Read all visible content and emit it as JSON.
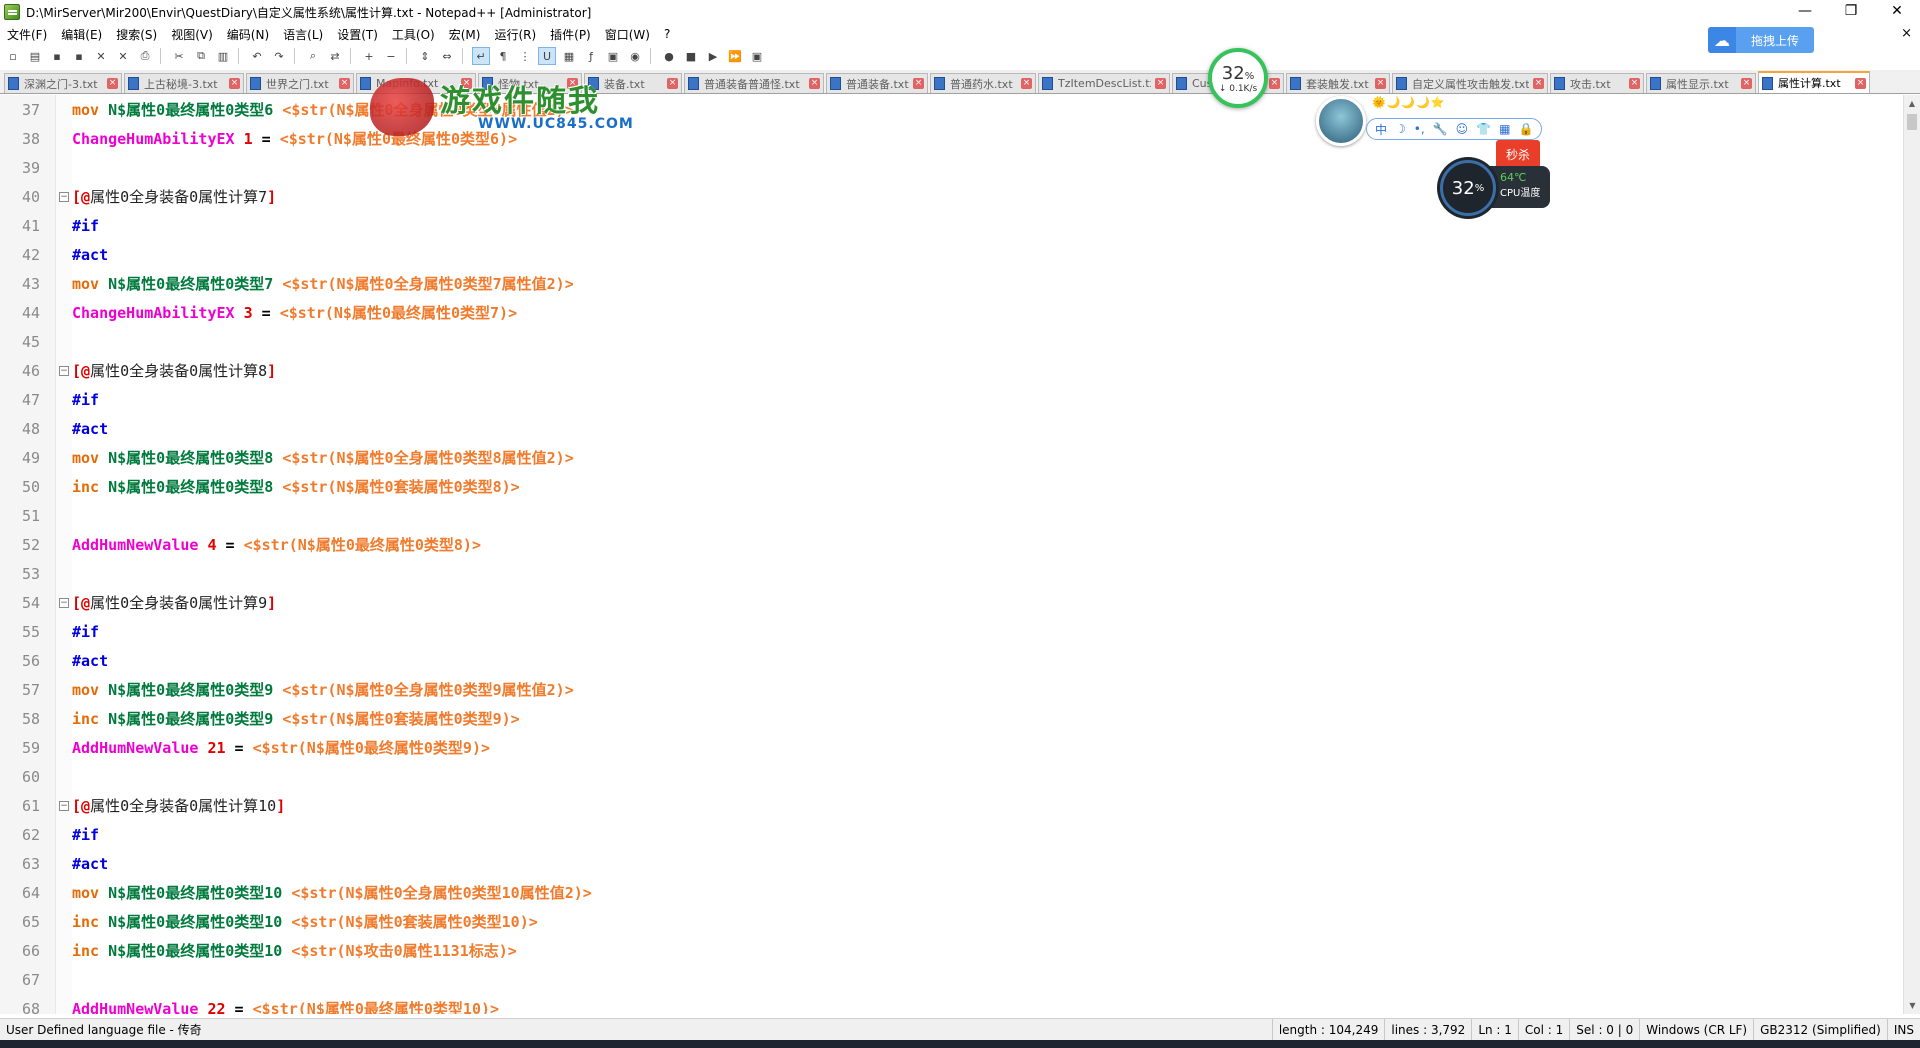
{
  "window": {
    "title": "D:\\MirServer\\Mir200\\Envir\\QuestDiary\\自定义属性系统\\属性计算.txt - Notepad++ [Administrator]",
    "controls": [
      "—",
      "❐",
      "✕"
    ]
  },
  "menu": {
    "items": [
      "文件(F)",
      "编辑(E)",
      "搜索(S)",
      "视图(V)",
      "编码(N)",
      "语言(L)",
      "设置(T)",
      "工具(O)",
      "宏(M)",
      "运行(R)",
      "插件(P)",
      "窗口(W)",
      "?"
    ],
    "close": "×"
  },
  "toolbar": {
    "icons": [
      "new-file-icon",
      "open-file-icon",
      "save-icon",
      "save-all-icon",
      "close-icon",
      "close-all-icon",
      "print-icon",
      "sep",
      "cut-icon",
      "copy-icon",
      "paste-icon",
      "sep",
      "undo-icon",
      "redo-icon",
      "sep",
      "find-icon",
      "replace-icon",
      "sep",
      "zoom-in-icon",
      "zoom-out-icon",
      "sep",
      "sync-v-icon",
      "sync-h-icon",
      "sep",
      "word-wrap-icon",
      "show-all-icon",
      "indent-guide-icon",
      "udl-icon",
      "doc-map-icon",
      "function-list-icon",
      "folder-workspace-icon",
      "monitor-icon",
      "sep",
      "record-macro-icon",
      "stop-macro-icon",
      "play-macro-icon",
      "run-macro-multiple-icon",
      "save-macro-icon"
    ],
    "glyphs": [
      "▫",
      "▤",
      "▪",
      "▪",
      "✕",
      "✕",
      "⎙",
      "",
      "✂",
      "⧉",
      "▥",
      "",
      "↶",
      "↷",
      "",
      "⌕",
      "⇄",
      "",
      "+",
      "−",
      "",
      "⇕",
      "⇔",
      "",
      "↵",
      "¶",
      "⋮",
      "U",
      "▦",
      "ƒ",
      "▣",
      "◉",
      "",
      "●",
      "■",
      "▶",
      "⏩",
      "▣"
    ]
  },
  "upload": {
    "label": "拖拽上传",
    "icon": "cloud-icon"
  },
  "tabs": [
    {
      "label": "深渊之门-3.txt"
    },
    {
      "label": "上古秘境-3.txt"
    },
    {
      "label": "世界之门.txt"
    },
    {
      "label": "Mapinfo.txt"
    },
    {
      "label": "怪物.txt"
    },
    {
      "label": "装备.txt"
    },
    {
      "label": "普通装备普通怪.txt"
    },
    {
      "label": "普通装备.txt"
    },
    {
      "label": "普通药水.txt"
    },
    {
      "label": "TzItemDescList.txt"
    },
    {
      "label": "Cust.txt"
    },
    {
      "label": "套装触发.txt"
    },
    {
      "label": "自定义属性攻击触发.txt"
    },
    {
      "label": "攻击.txt"
    },
    {
      "label": "属性显示.txt"
    },
    {
      "label": "属性计算.txt",
      "active": true
    }
  ],
  "editor": {
    "lines": [
      {
        "n": "37",
        "tokens": [
          [
            "kw",
            "mov "
          ],
          [
            "var",
            "N$属性0最终属性0类型6 "
          ],
          [
            "str",
            "<$str(N$属性0全身属性0类型6属性值2)>"
          ]
        ]
      },
      {
        "n": "38",
        "tokens": [
          [
            "fn",
            "ChangeHumAbilityEX "
          ],
          [
            "num",
            "1"
          ],
          [
            "op",
            " = "
          ],
          [
            "str",
            "<$str(N$属性0最终属性0类型6)>"
          ]
        ]
      },
      {
        "n": "39",
        "tokens": []
      },
      {
        "n": "40",
        "fold": true,
        "tokens": [
          [
            "br",
            "[@"
          ],
          [
            "lbl",
            "属性0全身装备0属性计算7"
          ],
          [
            "br",
            "]"
          ]
        ]
      },
      {
        "n": "41",
        "tokens": [
          [
            "dir",
            "#if"
          ]
        ]
      },
      {
        "n": "42",
        "tokens": [
          [
            "dir",
            "#act"
          ]
        ]
      },
      {
        "n": "43",
        "tokens": [
          [
            "kw",
            "mov "
          ],
          [
            "var",
            "N$属性0最终属性0类型7 "
          ],
          [
            "str",
            "<$str(N$属性0全身属性0类型7属性值2)>"
          ]
        ]
      },
      {
        "n": "44",
        "tokens": [
          [
            "fn",
            "ChangeHumAbilityEX "
          ],
          [
            "num",
            "3"
          ],
          [
            "op",
            " = "
          ],
          [
            "str",
            "<$str(N$属性0最终属性0类型7)>"
          ]
        ]
      },
      {
        "n": "45",
        "tokens": []
      },
      {
        "n": "46",
        "fold": true,
        "tokens": [
          [
            "br",
            "[@"
          ],
          [
            "lbl",
            "属性0全身装备0属性计算8"
          ],
          [
            "br",
            "]"
          ]
        ]
      },
      {
        "n": "47",
        "tokens": [
          [
            "dir",
            "#if"
          ]
        ]
      },
      {
        "n": "48",
        "tokens": [
          [
            "dir",
            "#act"
          ]
        ]
      },
      {
        "n": "49",
        "tokens": [
          [
            "kw",
            "mov "
          ],
          [
            "var",
            "N$属性0最终属性0类型8 "
          ],
          [
            "str",
            "<$str(N$属性0全身属性0类型8属性值2)>"
          ]
        ]
      },
      {
        "n": "50",
        "tokens": [
          [
            "kw",
            "inc "
          ],
          [
            "var",
            "N$属性0最终属性0类型8 "
          ],
          [
            "str",
            "<$str(N$属性0套装属性0类型8)>"
          ]
        ]
      },
      {
        "n": "51",
        "tokens": []
      },
      {
        "n": "52",
        "tokens": [
          [
            "fn",
            "AddHumNewValue "
          ],
          [
            "num",
            "4"
          ],
          [
            "op",
            " = "
          ],
          [
            "str",
            "<$str(N$属性0最终属性0类型8)>"
          ]
        ]
      },
      {
        "n": "53",
        "tokens": []
      },
      {
        "n": "54",
        "fold": true,
        "tokens": [
          [
            "br",
            "[@"
          ],
          [
            "lbl",
            "属性0全身装备0属性计算9"
          ],
          [
            "br",
            "]"
          ]
        ]
      },
      {
        "n": "55",
        "tokens": [
          [
            "dir",
            "#if"
          ]
        ]
      },
      {
        "n": "56",
        "tokens": [
          [
            "dir",
            "#act"
          ]
        ]
      },
      {
        "n": "57",
        "tokens": [
          [
            "kw",
            "mov "
          ],
          [
            "var",
            "N$属性0最终属性0类型9 "
          ],
          [
            "str",
            "<$str(N$属性0全身属性0类型9属性值2)>"
          ]
        ]
      },
      {
        "n": "58",
        "tokens": [
          [
            "kw",
            "inc "
          ],
          [
            "var",
            "N$属性0最终属性0类型9 "
          ],
          [
            "str",
            "<$str(N$属性0套装属性0类型9)>"
          ]
        ]
      },
      {
        "n": "59",
        "tokens": [
          [
            "fn",
            "AddHumNewValue "
          ],
          [
            "num",
            "21"
          ],
          [
            "op",
            " = "
          ],
          [
            "str",
            "<$str(N$属性0最终属性0类型9)>"
          ]
        ]
      },
      {
        "n": "60",
        "tokens": []
      },
      {
        "n": "61",
        "fold": true,
        "tokens": [
          [
            "br",
            "[@"
          ],
          [
            "lbl",
            "属性0全身装备0属性计算10"
          ],
          [
            "br",
            "]"
          ]
        ]
      },
      {
        "n": "62",
        "tokens": [
          [
            "dir",
            "#if"
          ]
        ]
      },
      {
        "n": "63",
        "tokens": [
          [
            "dir",
            "#act"
          ]
        ]
      },
      {
        "n": "64",
        "tokens": [
          [
            "kw",
            "mov "
          ],
          [
            "var",
            "N$属性0最终属性0类型10 "
          ],
          [
            "str",
            "<$str(N$属性0全身属性0类型10属性值2)>"
          ]
        ]
      },
      {
        "n": "65",
        "tokens": [
          [
            "kw",
            "inc "
          ],
          [
            "var",
            "N$属性0最终属性0类型10 "
          ],
          [
            "str",
            "<$str(N$属性0套装属性0类型10)>"
          ]
        ]
      },
      {
        "n": "66",
        "tokens": [
          [
            "kw",
            "inc "
          ],
          [
            "var",
            "N$属性0最终属性0类型10 "
          ],
          [
            "str",
            "<$str(N$攻击0属性1131标志)>"
          ]
        ]
      },
      {
        "n": "67",
        "tokens": []
      },
      {
        "n": "68",
        "tokens": [
          [
            "fn",
            "AddHumNewValue "
          ],
          [
            "num",
            "22"
          ],
          [
            "op",
            " = "
          ],
          [
            "str",
            "<$str(N$属性0最终属性0类型10)>"
          ]
        ]
      }
    ]
  },
  "statusbar": {
    "language": "User Defined language file - 传奇",
    "length": "length : 104,249",
    "lines": "lines : 3,792",
    "ln": "Ln : 1",
    "col": "Col : 1",
    "sel": "Sel : 0 | 0",
    "eol": "Windows (CR LF)",
    "encoding": "GB2312 (Simplified)",
    "mode": "INS"
  },
  "overlays": {
    "net_percent": "32",
    "net_percent_unit": "%",
    "net_speed": "↓ 0.1K/s",
    "watermark_title": "游戏件随我",
    "watermark_url": "WWW.UC845.COM",
    "avatar_stars": "🌞🌙🌙🌙⭐",
    "avatar_bar": [
      "中",
      "☽",
      "•,",
      "🔧",
      "☺",
      "👕",
      "▦",
      "🔒"
    ],
    "cpu_badge": "秒杀",
    "cpu_percent": "32",
    "cpu_percent_unit": "%",
    "cpu_temp": "64℃",
    "cpu_label": "CPU温度"
  },
  "colors": {
    "keyword": "#e36c09",
    "variable": "#007a3d",
    "string": "#f17b2c",
    "function": "#f000d0",
    "number": "#e00000",
    "directive": "#0000e0",
    "active_tab_accent": "#f4a540"
  }
}
